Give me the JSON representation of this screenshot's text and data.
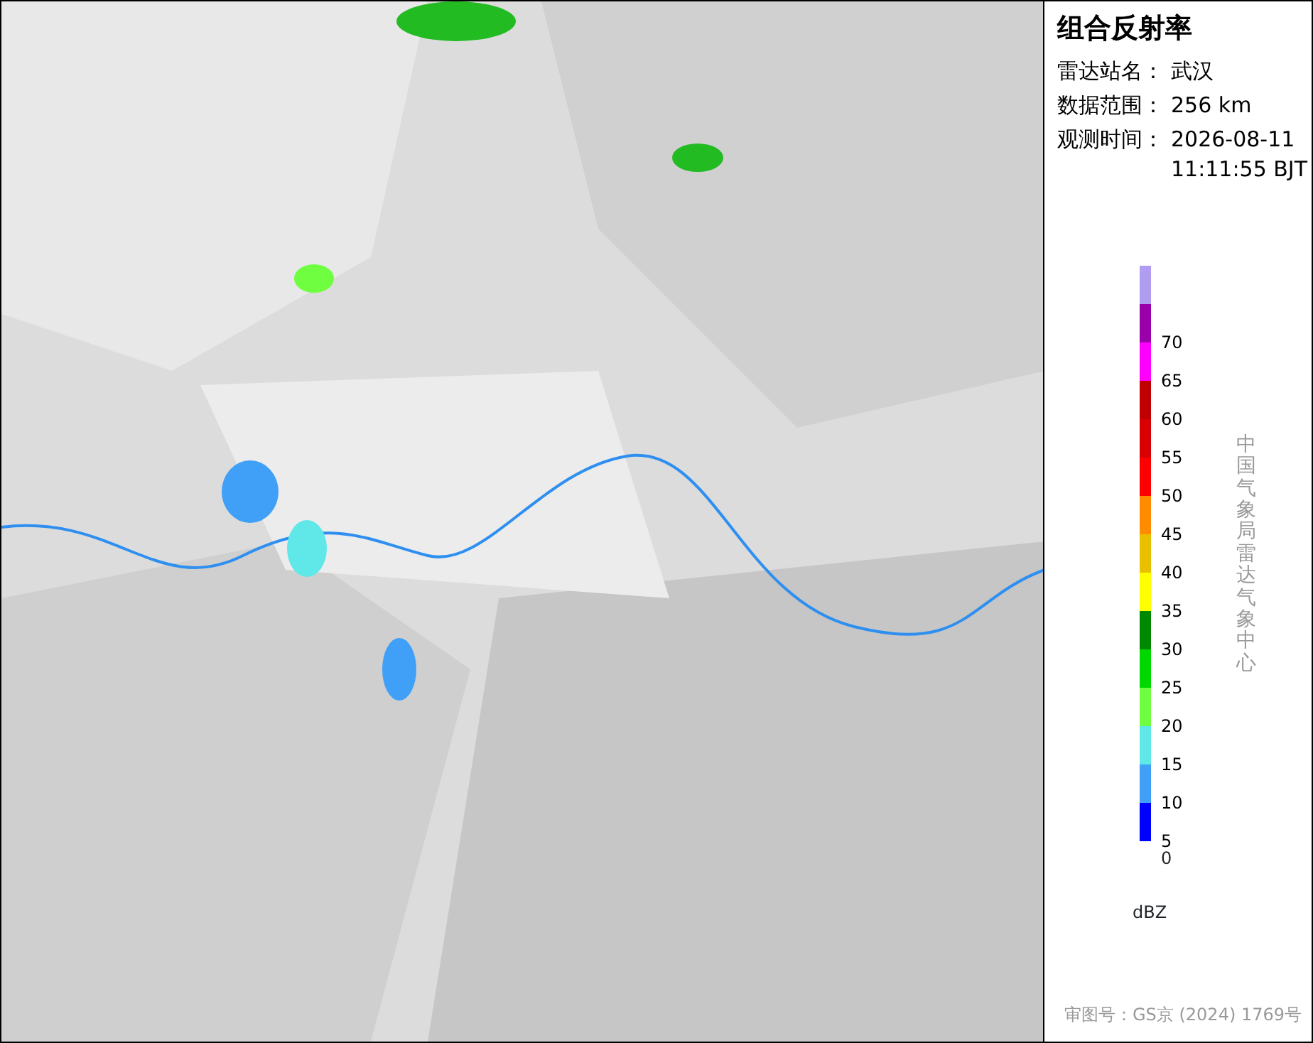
{
  "panel": {
    "title": "组合反射率",
    "info": [
      {
        "label": "雷达站名：",
        "value_lines": [
          "武汉"
        ]
      },
      {
        "label": "数据范围：",
        "value_lines": [
          "256 km"
        ]
      },
      {
        "label": "观测时间：",
        "value_lines": [
          "2026-08-11",
          "11:11:55 BJT"
        ]
      }
    ],
    "legend": {
      "unit": "dBZ",
      "bins": [
        {
          "color": "#b09cf0"
        },
        {
          "color": "#9900aa",
          "label": "70"
        },
        {
          "color": "#ff00ff",
          "label": "65"
        },
        {
          "color": "#c00000",
          "label": "60"
        },
        {
          "color": "#d80000",
          "label": "55"
        },
        {
          "color": "#ff0000",
          "label": "50"
        },
        {
          "color": "#ff8c00",
          "label": "45"
        },
        {
          "color": "#e8c000",
          "label": "40"
        },
        {
          "color": "#ffff00",
          "label": "35"
        },
        {
          "color": "#008800",
          "label": "30"
        },
        {
          "color": "#00d800",
          "label": "25"
        },
        {
          "color": "#70ff40",
          "label": "20"
        },
        {
          "color": "#60e8e8",
          "label": "15"
        },
        {
          "color": "#40a0f8",
          "label": "10"
        },
        {
          "color": "#0000ff",
          "label": "5"
        }
      ],
      "bottom_label": "0"
    },
    "credit": "中国气象局雷达气象中心",
    "approval": "审图号：GS京 (2024) 1769号"
  }
}
